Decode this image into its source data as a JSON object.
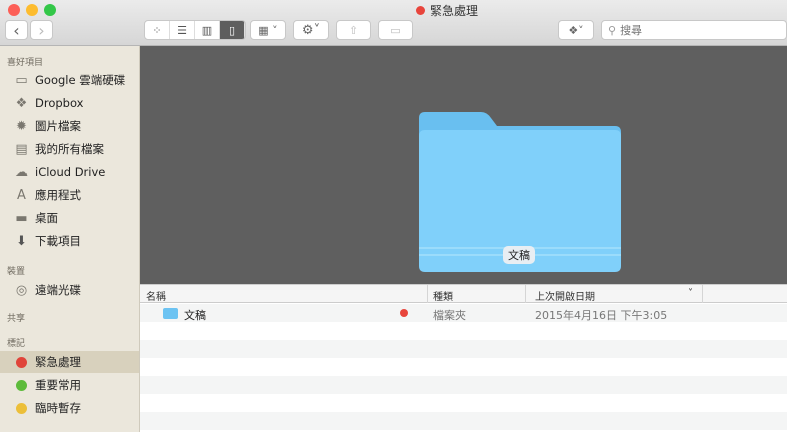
{
  "window": {
    "title": "緊急處理",
    "title_tag_color": "#e8453c"
  },
  "toolbar": {
    "back": "‹",
    "forward": "›",
    "view_icons": [
      "icon-view",
      "list-view",
      "column-view",
      "coverflow-view"
    ],
    "arrange": "arrange-menu",
    "action": "action-menu",
    "share": "share",
    "tags": "tags",
    "dropbox": "dropbox-menu",
    "search_placeholder": "搜尋"
  },
  "sidebar": {
    "favorites_header": "喜好項目",
    "favorites": [
      {
        "label": "Google 雲端硬碟",
        "icon": "folder-icon"
      },
      {
        "label": "Dropbox",
        "icon": "dropbox-icon"
      },
      {
        "label": "圖片檔案",
        "icon": "gear-icon"
      },
      {
        "label": "我的所有檔案",
        "icon": "all-files-icon"
      },
      {
        "label": "iCloud Drive",
        "icon": "cloud-icon"
      },
      {
        "label": "應用程式",
        "icon": "applications-icon"
      },
      {
        "label": "桌面",
        "icon": "desktop-icon"
      },
      {
        "label": "下載項目",
        "icon": "download-icon"
      }
    ],
    "devices_header": "裝置",
    "devices": [
      {
        "label": "遠端光碟",
        "icon": "disc-icon"
      }
    ],
    "shared_header": "共享",
    "tags_header": "標記",
    "tags": [
      {
        "label": "緊急處理",
        "color": "#e0443a"
      },
      {
        "label": "重要常用",
        "color": "#5dbb3b"
      },
      {
        "label": "臨時暫存",
        "color": "#ecbf39"
      }
    ]
  },
  "coverflow": {
    "label": "文稿"
  },
  "list": {
    "columns": [
      "名稱",
      "種類",
      "上次開啟日期"
    ],
    "rows": [
      {
        "name": "文稿",
        "tag_color": "#e8453c",
        "kind": "檔案夾",
        "date": "2015年4月16日 下午3:05"
      }
    ]
  }
}
